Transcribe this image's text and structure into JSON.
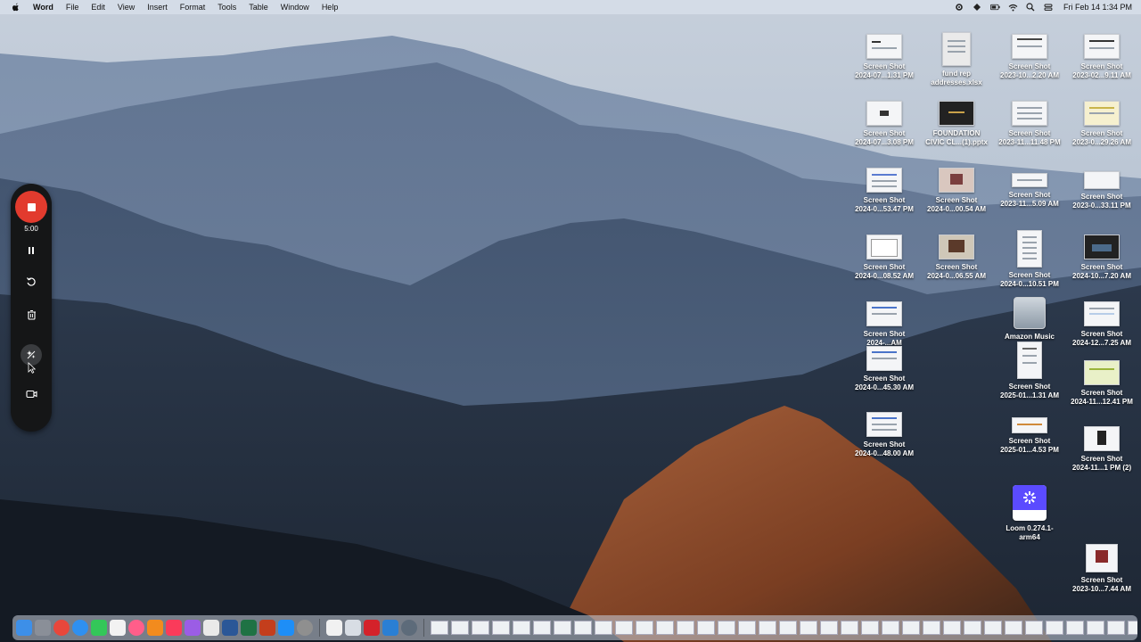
{
  "menubar": {
    "app_name": "Word",
    "items": [
      "File",
      "Edit",
      "View",
      "Insert",
      "Format",
      "Tools",
      "Table",
      "Window",
      "Help"
    ],
    "clock": "Fri Feb 14  1:34 PM"
  },
  "recorder": {
    "timer": "5:00"
  },
  "desktop_icons": [
    {
      "line1": "Screen Shot",
      "line2": "2024-07...1.31 PM"
    },
    {
      "line1": "fund rep",
      "line2": "addresses.xlsx"
    },
    {
      "line1": "Screen Shot",
      "line2": "2023-10...2.20 AM"
    },
    {
      "line1": "Screen Shot",
      "line2": "2023-02...9.11 AM"
    },
    {
      "line1": "Screen Shot",
      "line2": "2024-07...3.08 PM"
    },
    {
      "line1": "FOUNDATION",
      "line2": "CIVIC CL...(1).pptx"
    },
    {
      "line1": "Screen Shot",
      "line2": "2023-11...11.48 PM"
    },
    {
      "line1": "Screen Shot",
      "line2": "2023-0...29.26 AM"
    },
    {
      "line1": "Screen Shot",
      "line2": "2024-0...53.47 PM"
    },
    {
      "line1": "Screen Shot",
      "line2": "2024-0...00.54 AM"
    },
    {
      "line1": "Screen Shot",
      "line2": "2023-11...5.09 AM"
    },
    {
      "line1": "Screen Shot",
      "line2": "2023-0...33.11 PM"
    },
    {
      "line1": "Screen Shot",
      "line2": "2024-0...08.52 AM"
    },
    {
      "line1": "Screen Shot",
      "line2": "2024-0...06.55 AM"
    },
    {
      "line1": "Screen Shot",
      "line2": "2024-0...10.51 PM"
    },
    {
      "line1": "Screen Shot",
      "line2": "2024-10...7.20 AM"
    },
    {
      "line1": "Screen Shot",
      "line2": "2024-...AM"
    },
    {
      "line1": "Amazon Music",
      "line2": ""
    },
    {
      "line1": "Screen Shot",
      "line2": "2024-12...7.25 AM"
    },
    {
      "line1": "Screen Shot",
      "line2": "2024-0...45.30 AM"
    },
    {
      "line1": "Screen Shot",
      "line2": "2025-01...1.31 AM"
    },
    {
      "line1": "Screen Shot",
      "line2": "2024-11...12.41 PM"
    },
    {
      "line1": "Screen Shot",
      "line2": "2024-0...48.00 AM"
    },
    {
      "line1": "Screen Shot",
      "line2": "2025-01...4.53 PM"
    },
    {
      "line1": "Screen Shot",
      "line2": "2024-11...1 PM (2)"
    },
    {
      "line1": "Loom 0.274.1-",
      "line2": "arm64"
    },
    {
      "line1": "Screen Shot",
      "line2": "2023-10...7.44 AM"
    }
  ],
  "colors": {
    "record_red": "#e23b2e",
    "recorder_bg": "#151617",
    "loom_purple": "#5b4bff"
  }
}
